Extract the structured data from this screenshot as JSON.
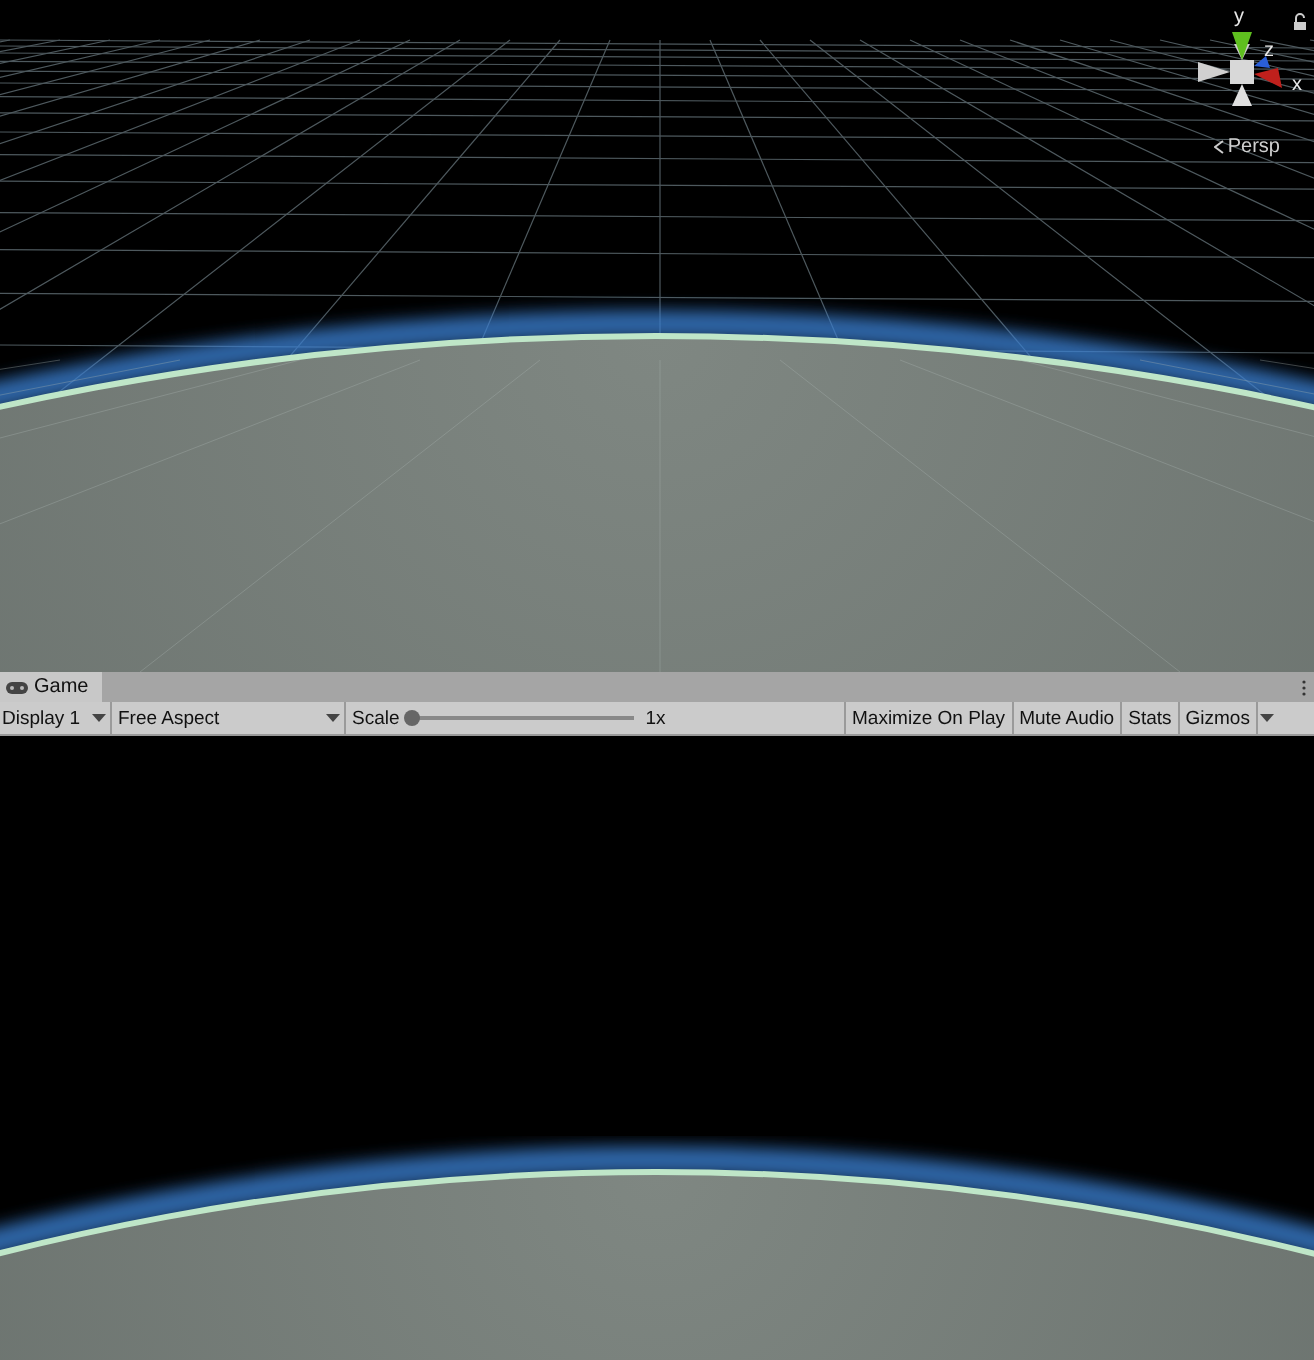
{
  "scene_view": {
    "gizmo_axes": [
      {
        "label": "y",
        "color": "#5fbf1f"
      },
      {
        "label": "z",
        "color": "#2a5fd8"
      },
      {
        "label": "x",
        "color": "#c0201c"
      }
    ],
    "projection_label": "Persp"
  },
  "tabs": [
    {
      "label": "Game",
      "selected": true
    }
  ],
  "toolbar": {
    "display_dropdown": "Display 1",
    "aspect_dropdown": "Free Aspect",
    "scale": {
      "label": "Scale",
      "level": 0.0,
      "reading": "1x"
    },
    "toggles": [
      {
        "label": "Maximize On Play",
        "on": false
      },
      {
        "label": "Mute Audio",
        "on": false
      },
      {
        "label": "Stats",
        "on": false
      },
      {
        "label": "Gizmos",
        "on": false
      }
    ]
  }
}
